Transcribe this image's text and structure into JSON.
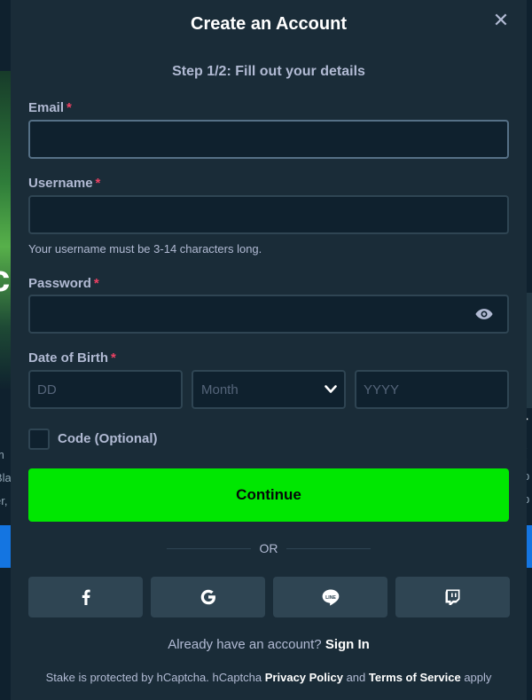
{
  "background": {
    "left_glyph": "c",
    "left_text": [
      "m",
      "Bla",
      "er,"
    ],
    "right_glyph": "r",
    "right_text": [
      "(",
      "p",
      "p"
    ]
  },
  "modal": {
    "title": "Create an Account",
    "close_icon": "close-icon",
    "step_text": "Step 1/2: Fill out your details"
  },
  "form": {
    "email_label": "Email",
    "username_label": "Username",
    "username_hint": "Your username must be 3-14 characters long.",
    "password_label": "Password",
    "dob_label": "Date of Birth",
    "required_mark": "*",
    "dob_day_placeholder": "DD",
    "dob_month_value": "Month",
    "dob_year_placeholder": "YYYY",
    "code_label": "Code (Optional)",
    "continue_label": "Continue"
  },
  "divider": {
    "text": "OR"
  },
  "social": [
    {
      "name": "facebook",
      "icon": "facebook-icon"
    },
    {
      "name": "google",
      "icon": "google-icon"
    },
    {
      "name": "line",
      "icon": "line-icon"
    },
    {
      "name": "twitch",
      "icon": "twitch-icon"
    }
  ],
  "signin": {
    "prompt": "Already have an account?",
    "link": "Sign In"
  },
  "footer": {
    "prefix": "Stake is protected by hCaptcha. hCaptcha",
    "privacy_link": "Privacy Policy",
    "and": "and",
    "terms_link": "Terms of Service",
    "suffix": "apply"
  },
  "colors": {
    "modal_bg": "#1a2c38",
    "input_bg": "#0f212e",
    "input_border": "#2f4553",
    "accent_green": "#00e701",
    "required_red": "#ed4163",
    "label_gray": "#b1bad3"
  }
}
